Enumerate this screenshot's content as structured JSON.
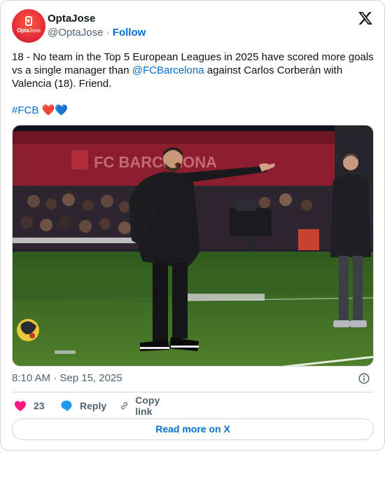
{
  "author": {
    "name": "OptaJose",
    "handle": "@OptaJose",
    "separator": "·",
    "follow_label": "Follow",
    "avatar_text_bold": "Opta",
    "avatar_text_light": "Jose"
  },
  "tweet": {
    "text_before_mention": "18 - No team in the Top 5 European Leagues in 2025 have scored more goals vs a single manager than ",
    "mention": "@FCBarcelona",
    "text_after_mention": " against Carlos Corberán with Valencia (18). Friend.",
    "hashtag": "#FCB",
    "emoji_red_heart": "❤️",
    "emoji_blue_heart": "💙"
  },
  "media": {
    "banner_text": "FC BARCELONA"
  },
  "meta": {
    "timestamp": "8:10 AM · Sep 15, 2025"
  },
  "actions": {
    "likes_count": "23",
    "reply_label": "Reply",
    "copy_link_label": "Copy link"
  },
  "footer": {
    "read_more_label": "Read more on X"
  },
  "icons": {
    "x_logo": "x-logo-icon",
    "info": "info-icon",
    "like": "heart-icon",
    "reply": "speech-bubble-icon",
    "copy_link": "link-icon"
  },
  "colors": {
    "accent_link": "#006fd6",
    "like_pink": "#f91880",
    "reply_blue": "#1d9bf0",
    "secondary_text": "#536471",
    "border": "#cfd9de"
  }
}
